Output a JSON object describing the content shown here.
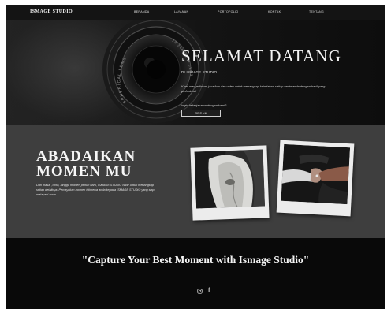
{
  "navbar": {
    "brand": "ISMAGE STUDIO",
    "links": [
      "BERANDA",
      "LAYANAN",
      "PORTOFOLIO",
      "KONTAK",
      "TENTANG"
    ]
  },
  "hero": {
    "title": "SELAMAT DATANG",
    "subtitle": "DI ISMAGE STUDIO",
    "description": "Kami menyediakan jasa foto dan video untuk menangkap keindahan setiap cerita anda dengan hasil yang profesional",
    "cta_text": "Ingin bekerjasama dengan kami?",
    "button_label": "PESAN",
    "lens_text_1": "SPHERICAL LENS",
    "lens_text_2": "12-24mm 1:4 LENS"
  },
  "moment": {
    "title": "ABADAIKAN\nMOMEN MU",
    "description": "Dari masa, ,cinta, hingga momen penuh haru, ISMAGE STUDIO hadir untuk menangkap setiap detailnya. Percayakan momen istimewa anda kepada ISMAGE STUDIO yang siap melayani anda."
  },
  "footer": {
    "quote": "\"Capture Your Best Moment with Ismage Studio\"",
    "social": [
      "instagram-icon",
      "facebook-icon"
    ],
    "facebook_glyph": "f"
  },
  "colors": {
    "nav_bg": "#141414",
    "hero_bg": "#131313",
    "section_gray": "#3e3e3e",
    "footer_bg": "#090909",
    "text_light": "#f4f4f4",
    "accent_line": "#5a2a3a"
  }
}
